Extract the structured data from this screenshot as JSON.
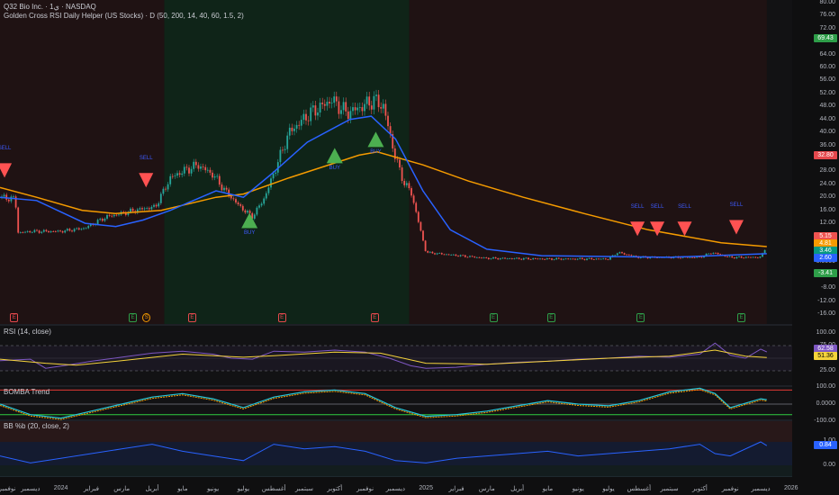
{
  "header": {
    "symbol_line": "Q32 Bio Inc. · 1ي · NASDAQ",
    "indicator_line": "Golden Cross RSI Daily Helper (US Stocks) · D (50, 200, 14, 40, 60, 1.5, 2)"
  },
  "panes": {
    "rsi_title": "RSI (14, close)",
    "bomba_title": "BOMBA Trend",
    "bb_title": "BB %b (20, close, 2)"
  },
  "price_axis": [
    "80.00",
    "76.00",
    "72.00",
    "68.00",
    "64.00",
    "60.00",
    "56.00",
    "52.00",
    "48.00",
    "44.00",
    "40.00",
    "36.00",
    "32.00",
    "28.00",
    "24.00",
    "20.00",
    "16.00",
    "12.00",
    "8.00",
    "4.00",
    "0.0000",
    "-4.00",
    "-8.00",
    "-12.00",
    "-16.00"
  ],
  "price_tags": [
    {
      "value": "69.43",
      "color": "#2e9e49"
    },
    {
      "value": "32.80",
      "color": "#e5484d"
    },
    {
      "value": "5.15",
      "color": "#ef5350"
    },
    {
      "value": "4.81",
      "color": "#f59b00"
    },
    {
      "value": "3.46",
      "color": "#089981"
    },
    {
      "value": "2.60",
      "color": "#2962ff"
    },
    {
      "value": "-3.41",
      "color": "#2e9e49"
    }
  ],
  "rsi_axis": [
    "100.00",
    "75.00",
    "25.00"
  ],
  "rsi_tags": [
    {
      "value": "62.58",
      "color": "#7e57c2"
    },
    {
      "value": "51.36",
      "color": "#f5d33b"
    }
  ],
  "bomba_axis": [
    "100.00",
    "0.0000",
    "-100.00"
  ],
  "bb_axis": [
    "1.00",
    "0.00"
  ],
  "bb_tags": [
    {
      "value": "0.84",
      "color": "#2962ff"
    }
  ],
  "time_axis": [
    "نوفمبر",
    "ديسمبر",
    "2024",
    "فبراير",
    "مارس",
    "أبريل",
    "مايو",
    "يونيو",
    "يوليو",
    "أغسطس",
    "سبتمبر",
    "أكتوبر",
    "نوفمبر",
    "ديسمبر",
    "2025",
    "فبراير",
    "مارس",
    "أبريل",
    "مايو",
    "يونيو",
    "يوليو",
    "أغسطس",
    "سبتمبر",
    "أكتوبر",
    "نوفمبر",
    "ديسمبر",
    "2026"
  ],
  "chart_data": {
    "type": "line",
    "title": "Q32 Bio Inc. · NASDAQ",
    "x_unit": "months since 2023-11",
    "ylim": [
      -16,
      80
    ],
    "price": {
      "x": [
        0,
        0.5,
        0.6,
        1,
        2,
        2.8,
        3.5,
        4.7,
        5.1,
        5.6,
        6,
        6.5,
        7,
        7.4,
        7.9,
        8.3,
        8.7,
        9.5,
        10.2,
        10.9,
        11.4,
        11.9,
        12.3,
        12.6,
        13,
        13.3,
        13.5,
        14,
        16,
        18,
        20,
        20.3,
        21,
        23,
        23.4,
        24,
        25,
        25.2
      ],
      "y": [
        20,
        19.5,
        9,
        9.5,
        9.5,
        10.5,
        14,
        16.5,
        17,
        26,
        28,
        30,
        27,
        22,
        17,
        14,
        20,
        40,
        46,
        50,
        46,
        48,
        50,
        48,
        32,
        24,
        22,
        3,
        1.2,
        1,
        1,
        3,
        1.5,
        1.5,
        3,
        1.5,
        1.5,
        5.15
      ]
    },
    "sma50": {
      "x": [
        0,
        1.2,
        2.8,
        3.8,
        4.7,
        5.6,
        7.1,
        8,
        8.9,
        10.1,
        11.5,
        12.2,
        13,
        13.9,
        14.8,
        16,
        17.8,
        22,
        25.2
      ],
      "y": [
        20,
        19,
        12,
        11,
        13,
        16,
        22,
        20,
        27,
        37,
        44,
        45,
        38,
        22,
        10,
        4,
        2,
        1.5,
        2.6
      ]
    },
    "sma200": {
      "x": [
        0,
        1.2,
        2.7,
        3.8,
        5.3,
        7.1,
        8,
        9.5,
        11.8,
        12.4,
        13.9,
        15.4,
        17.2,
        19.2,
        21.3,
        23.7,
        25.2
      ],
      "y": [
        23,
        20,
        16,
        15,
        16,
        20,
        21,
        26,
        33,
        34,
        30,
        25,
        20,
        15,
        10,
        6,
        4.81
      ]
    },
    "signals": [
      {
        "type": "SELL",
        "x": 0.15,
        "y": 28
      },
      {
        "type": "SELL",
        "x": 4.8,
        "y": 25
      },
      {
        "type": "BUY",
        "x": 8.2,
        "y": 13
      },
      {
        "type": "BUY",
        "x": 11,
        "y": 33
      },
      {
        "type": "BUY",
        "x": 12.35,
        "y": 38
      },
      {
        "type": "SELL",
        "x": 20.95,
        "y": 10
      },
      {
        "type": "SELL",
        "x": 21.6,
        "y": 10
      },
      {
        "type": "SELL",
        "x": 22.5,
        "y": 10
      },
      {
        "type": "SELL",
        "x": 24.2,
        "y": 10.5
      }
    ],
    "events": [
      {
        "label": "E",
        "x": 0.45,
        "color": "#e5484d"
      },
      {
        "label": "E",
        "x": 4.35,
        "color": "#2e9e49"
      },
      {
        "label": "S",
        "x": 4.8,
        "color": "#f59b00"
      },
      {
        "label": "E",
        "x": 6.3,
        "color": "#e5484d"
      },
      {
        "label": "E",
        "x": 9.25,
        "color": "#e5484d"
      },
      {
        "label": "E",
        "x": 12.3,
        "color": "#e5484d"
      },
      {
        "label": "E",
        "x": 16.2,
        "color": "#2e9e49"
      },
      {
        "label": "E",
        "x": 18.1,
        "color": "#2e9e49"
      },
      {
        "label": "E",
        "x": 21.05,
        "color": "#2e9e49"
      },
      {
        "label": "E",
        "x": 24.35,
        "color": "#2e9e49"
      }
    ],
    "regimes": [
      {
        "from": 0,
        "to": 5.4,
        "state": "bear"
      },
      {
        "from": 5.4,
        "to": 13.45,
        "state": "bull"
      },
      {
        "from": 13.45,
        "to": 25.2,
        "state": "bear"
      }
    ],
    "rsi": {
      "x": [
        0,
        1,
        1.5,
        2.2,
        3,
        4,
        5,
        6,
        7,
        7.6,
        8.3,
        9,
        10,
        11,
        12,
        12.8,
        13.5,
        14,
        15,
        16,
        17,
        18,
        19,
        20,
        21,
        22,
        23,
        23.5,
        24,
        24.5,
        25,
        25.2
      ],
      "y": [
        45,
        48,
        30,
        36,
        44,
        52,
        60,
        64,
        58,
        50,
        48,
        64,
        62,
        66,
        62,
        50,
        35,
        30,
        32,
        38,
        42,
        44,
        48,
        50,
        54,
        52,
        58,
        80,
        56,
        50,
        68,
        62.58
      ]
    },
    "rsi_ma": {
      "x": [
        0,
        1.5,
        2.5,
        4,
        6,
        8,
        9,
        11,
        12.5,
        14,
        16,
        18,
        20,
        22,
        23.5,
        24.5,
        25.2
      ],
      "y": [
        48,
        40,
        36,
        45,
        58,
        52,
        55,
        62,
        60,
        40,
        38,
        44,
        50,
        54,
        66,
        54,
        51.36
      ]
    },
    "bomba": {
      "x": [
        0,
        1,
        2,
        3,
        4,
        5,
        6,
        7,
        8,
        9,
        10,
        11,
        12,
        13,
        14,
        15,
        16,
        17,
        18,
        19,
        20,
        21,
        22,
        23,
        23.5,
        24,
        25,
        25.2
      ],
      "y": [
        0,
        -60,
        -80,
        -40,
        0,
        40,
        60,
        30,
        -20,
        40,
        70,
        80,
        60,
        -20,
        -70,
        -60,
        -40,
        -10,
        20,
        0,
        -10,
        20,
        70,
        90,
        60,
        -20,
        30,
        25
      ]
    },
    "bb_pctb": {
      "x": [
        0,
        1,
        2,
        3,
        4,
        5,
        6,
        7,
        8,
        9,
        10,
        11,
        12,
        13,
        14,
        15,
        16,
        17,
        18,
        19,
        20,
        21,
        22,
        23,
        23.5,
        24,
        25,
        25.2
      ],
      "y": [
        0.4,
        0.1,
        0.3,
        0.5,
        0.7,
        0.9,
        0.6,
        0.4,
        0.2,
        0.9,
        0.7,
        0.8,
        0.6,
        0.2,
        0.1,
        0.3,
        0.4,
        0.5,
        0.6,
        0.4,
        0.5,
        0.6,
        0.7,
        0.9,
        0.5,
        0.4,
        1.0,
        0.84
      ]
    }
  },
  "colors": {
    "bull_bg": "#0f2418",
    "bear_bg": "#1f1213",
    "sma50": "#2962ff",
    "sma200": "#f59b00",
    "up": "#26a69a",
    "down": "#ef5350",
    "buy": "#4caf50",
    "sell": "#ff5252"
  }
}
